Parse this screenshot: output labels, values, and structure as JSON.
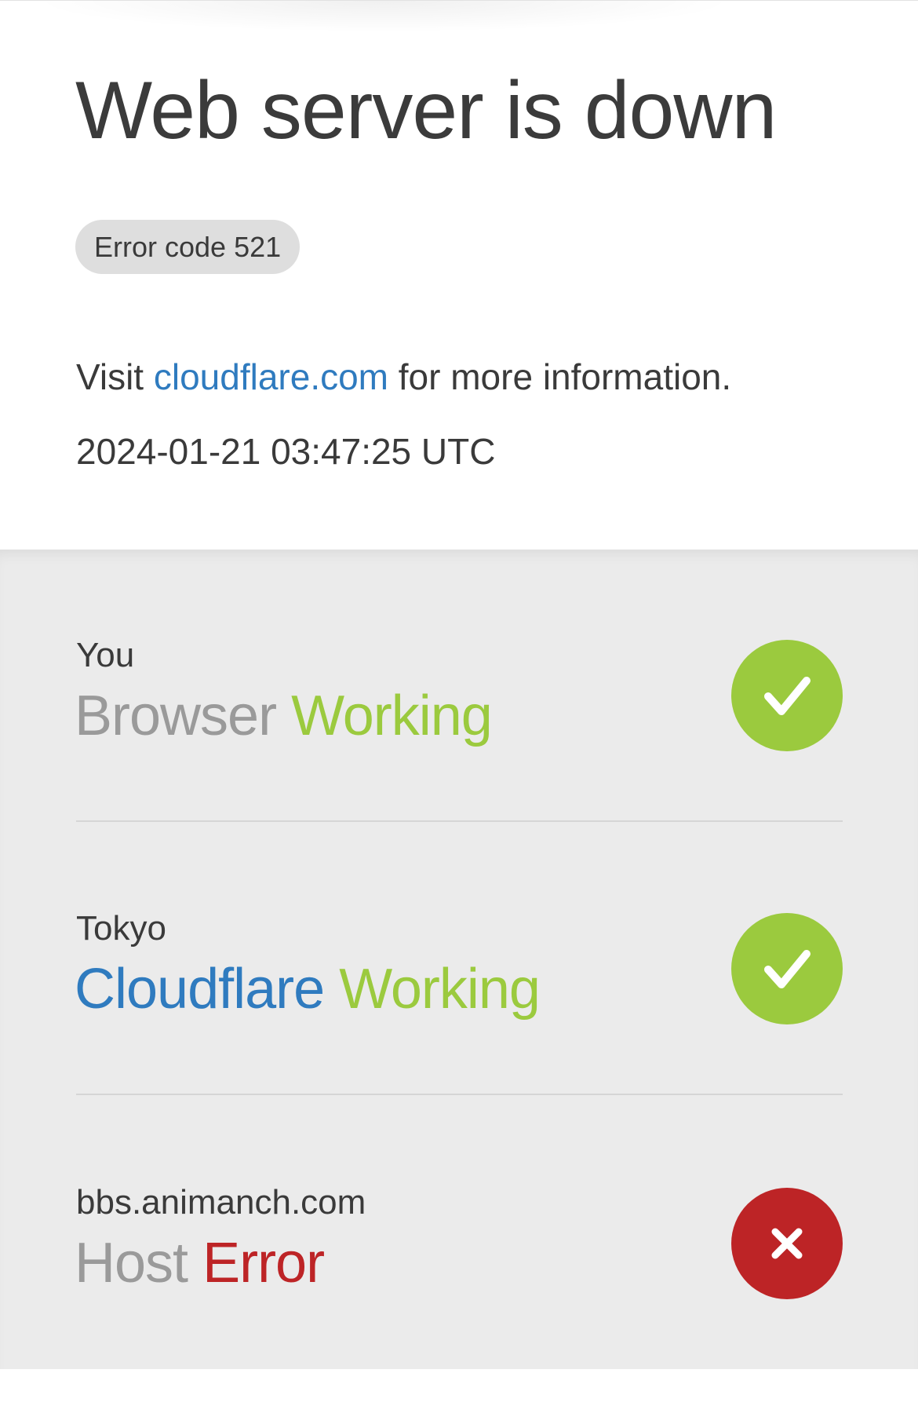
{
  "header": {
    "title": "Web server is down",
    "error_badge": "Error code 521",
    "visit_prefix": "Visit ",
    "visit_link": "cloudflare.com",
    "visit_suffix": " for more information.",
    "timestamp": "2024-01-21 03:47:25 UTC"
  },
  "status_items": [
    {
      "location": "You",
      "name": "Browser",
      "state": "Working",
      "result": "ok",
      "icon": "checkmark-icon"
    },
    {
      "location": "Tokyo",
      "name": "Cloudflare",
      "state": "Working",
      "result": "ok",
      "icon": "checkmark-icon"
    },
    {
      "location": "bbs.animanch.com",
      "name": "Host",
      "state": "Error",
      "result": "error",
      "icon": "x-icon"
    }
  ],
  "colors": {
    "working_green": "#9bca3e",
    "error_red": "#bd2426",
    "link_blue": "#2f7bbf",
    "muted_grey": "#9a9a9a",
    "section_bg": "#ebebeb"
  }
}
